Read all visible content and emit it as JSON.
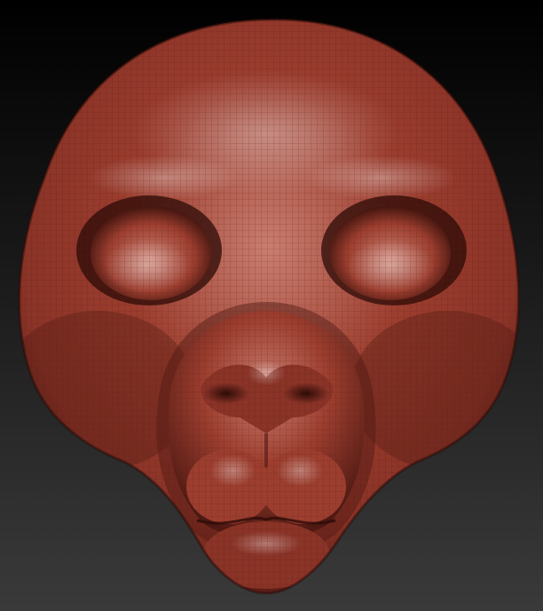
{
  "scene": {
    "subject": "sculpted-head-wireframe-render",
    "colors": {
      "background_top": "#000000",
      "background_bottom": "#3a3a3a",
      "material_base": "#9c3e2f",
      "material_light": "#c97e70",
      "material_mid": "#8a3327",
      "material_shadow": "#4e1912",
      "material_deep": "#2a0a06",
      "wire": "#5a1c14"
    }
  }
}
